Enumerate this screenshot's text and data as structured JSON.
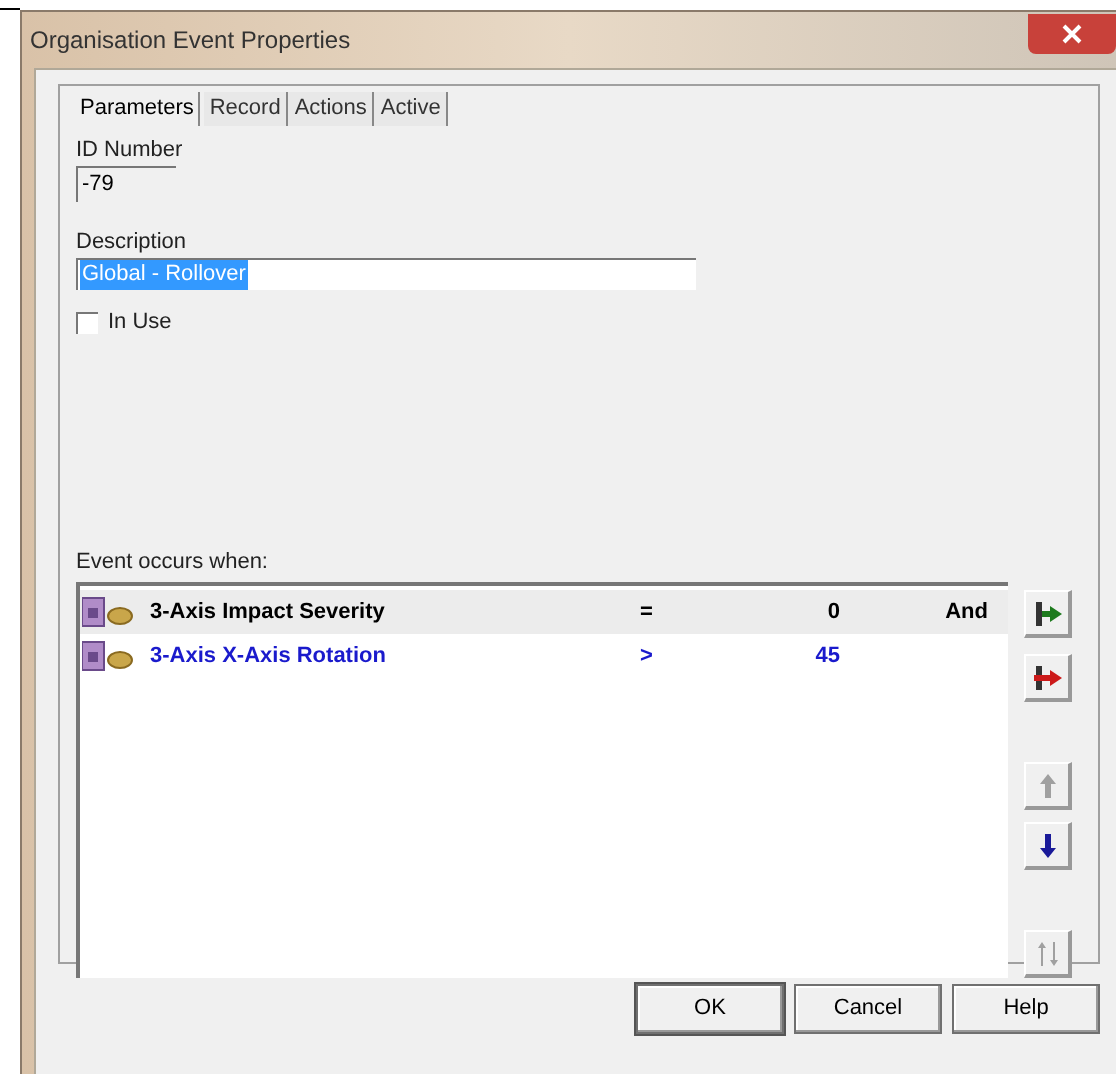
{
  "window": {
    "title": "Organisation Event Properties"
  },
  "tabs": [
    {
      "label": "Parameters",
      "selected": true
    },
    {
      "label": "Record",
      "selected": false
    },
    {
      "label": "Actions",
      "selected": false
    },
    {
      "label": "Active",
      "selected": false
    }
  ],
  "id_number": {
    "label": "ID Number",
    "value": "-79"
  },
  "description": {
    "label": "Description",
    "value": "Global - Rollover"
  },
  "in_use": {
    "label": "In Use",
    "checked": false
  },
  "conditions": {
    "label": "Event occurs when:",
    "rows": [
      {
        "field": "3-Axis Impact Severity",
        "operator": "=",
        "value": "0",
        "join": "And",
        "selected": true,
        "color": "#000000"
      },
      {
        "field": "3-Axis X-Axis Rotation",
        "operator": ">",
        "value": "45",
        "selected": false,
        "color": "#1a1acc"
      }
    ]
  },
  "side_buttons": [
    {
      "kind": "add",
      "disabled": false
    },
    {
      "kind": "remove",
      "disabled": false
    },
    {
      "kind": "up",
      "disabled": true
    },
    {
      "kind": "down",
      "disabled": false
    },
    {
      "kind": "swap",
      "disabled": true
    }
  ],
  "buttons": [
    "OK",
    "Cancel",
    "Help"
  ]
}
